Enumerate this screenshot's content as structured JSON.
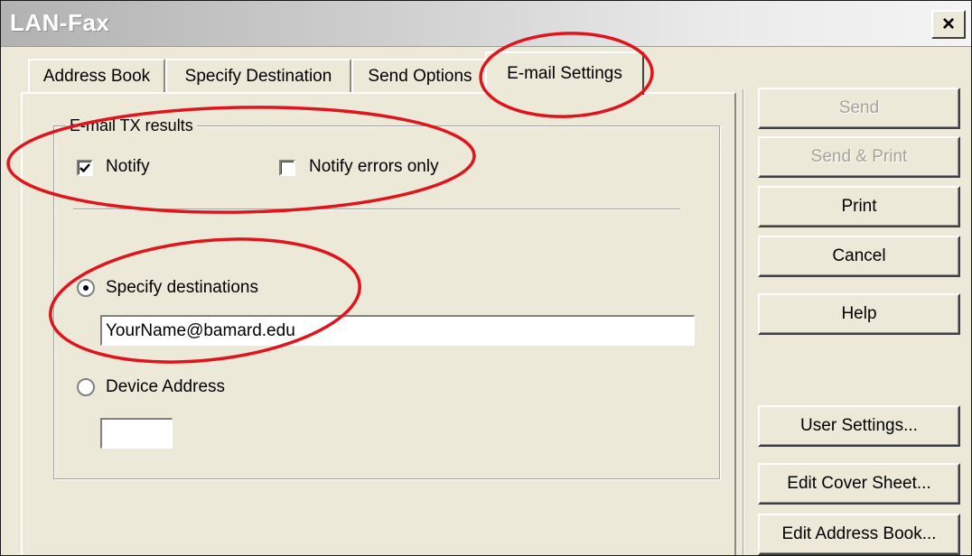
{
  "window": {
    "title": "LAN-Fax",
    "close_label": "×"
  },
  "tabs": [
    {
      "label": "Address Book",
      "active": false
    },
    {
      "label": "Specify Destination",
      "active": false
    },
    {
      "label": "Send Options",
      "active": false
    },
    {
      "label": "E-mail Settings",
      "active": true
    }
  ],
  "email_settings": {
    "group_title": "E-mail TX results",
    "notify_label": "Notify",
    "notify_checked": true,
    "notify_errors_label": "Notify errors only",
    "notify_errors_checked": false,
    "specify_destinations_label": "Specify destinations",
    "specify_destinations_selected": true,
    "destination_value": "YourName@bamard.edu",
    "device_address_label": "Device Address",
    "device_address_selected": false,
    "device_address_value": ""
  },
  "buttons": {
    "send": "Send",
    "send_print": "Send & Print",
    "print": "Print",
    "cancel": "Cancel",
    "help": "Help",
    "user_settings": "User Settings...",
    "edit_cover_sheet": "Edit Cover Sheet...",
    "edit_address_book": "Edit Address Book..."
  },
  "colors": {
    "annotation": "#e0141c",
    "dialog_face": "#ece9d8"
  },
  "icons": {
    "checkmark": "check-icon",
    "close": "close-icon"
  }
}
